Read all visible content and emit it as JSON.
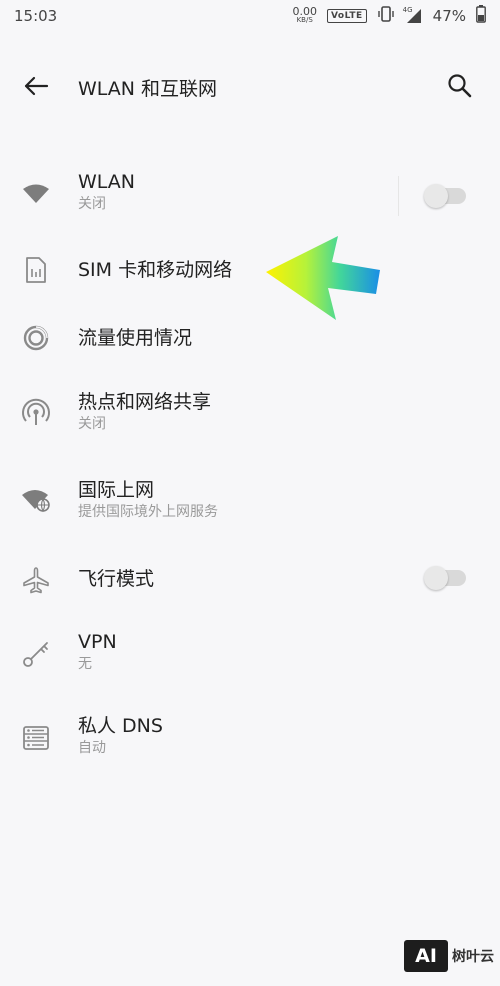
{
  "status_bar": {
    "time": "15:03",
    "net_speed": "0.00",
    "net_unit": "KB/S",
    "volte": "VoLTE",
    "signal_type": "4G",
    "battery": "47%"
  },
  "app_bar": {
    "title": "WLAN 和互联网",
    "back_icon": "back-arrow-icon",
    "search_icon": "search-icon"
  },
  "items": [
    {
      "title": "WLAN",
      "subtitle": "关闭",
      "icon": "wifi-icon",
      "toggle": false
    },
    {
      "title": "SIM 卡和移动网络",
      "subtitle": "",
      "icon": "sim-card-icon"
    },
    {
      "title": "流量使用情况",
      "subtitle": "",
      "icon": "data-usage-icon"
    },
    {
      "title": "热点和网络共享",
      "subtitle": "关闭",
      "icon": "hotspot-icon"
    },
    {
      "title": "国际上网",
      "subtitle": "提供国际境外上网服务",
      "icon": "global-roaming-icon"
    },
    {
      "title": "飞行模式",
      "subtitle": "",
      "icon": "airplane-icon",
      "toggle": false
    },
    {
      "title": "VPN",
      "subtitle": "无",
      "icon": "vpn-key-icon"
    },
    {
      "title": "私人 DNS",
      "subtitle": "自动",
      "icon": "dns-icon"
    }
  ],
  "watermark": {
    "logo": "AI",
    "text": "树叶云"
  },
  "colors": {
    "background": "#f7f7f9",
    "icon_gray": "#8a8a8a",
    "toggle_off": "#d9d9d9"
  }
}
